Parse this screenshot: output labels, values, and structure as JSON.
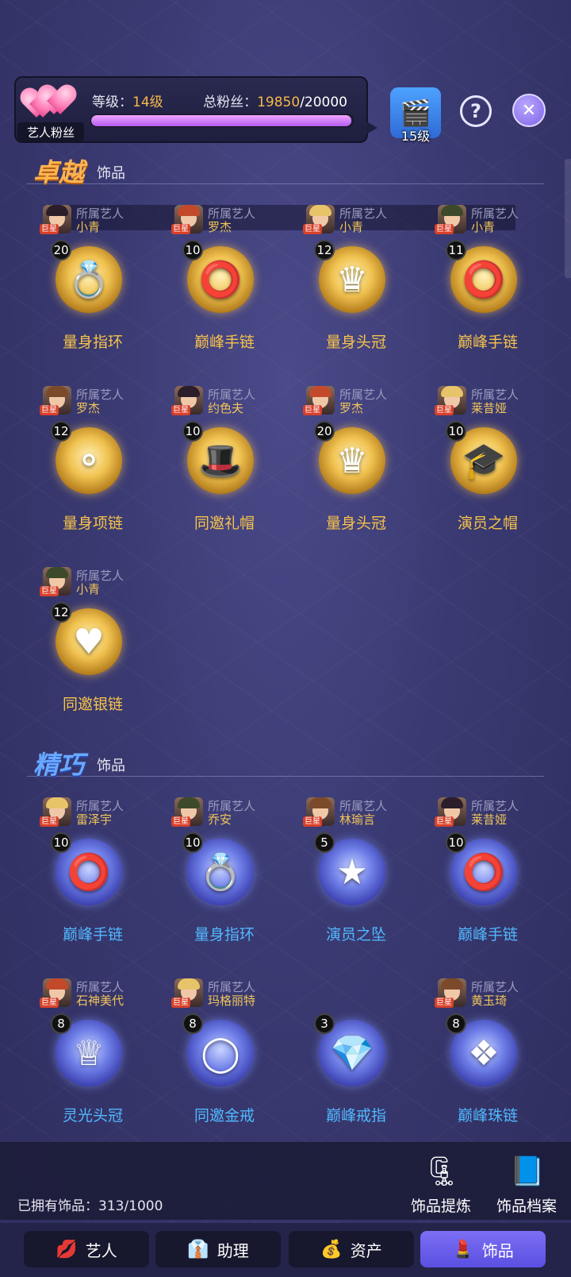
{
  "header": {
    "fan_tag": "艺人粉丝",
    "level_label": "等级：",
    "level_value": "14级",
    "fans_label": "总粉丝：",
    "fans_value": "19850",
    "fans_max": "/20000",
    "fans_progress_fraction": 0.9925,
    "next_level": "15级"
  },
  "sections": {
    "excellent": {
      "title": "卓越",
      "sub": "饰品"
    },
    "exquisite": {
      "title": "精巧",
      "sub": "饰品"
    }
  },
  "owner_label": "所属艺人",
  "star_badge": "巨星",
  "excellent_items": [
    {
      "owner": "小青",
      "count": "20",
      "name": "量身指环",
      "icon": "ring-icon",
      "glyph": "💍"
    },
    {
      "owner": "罗杰",
      "count": "10",
      "name": "巅峰手链",
      "icon": "bracelet-icon",
      "glyph": "⭕"
    },
    {
      "owner": "小青",
      "count": "12",
      "name": "量身头冠",
      "icon": "crown-icon",
      "glyph": "♛"
    },
    {
      "owner": "小青",
      "count": "11",
      "name": "巅峰手链",
      "icon": "bracelet-icon",
      "glyph": "⭕"
    },
    {
      "owner": "罗杰",
      "count": "12",
      "name": "量身项链",
      "icon": "necklace-icon",
      "glyph": "⚬"
    },
    {
      "owner": "约色夫",
      "count": "10",
      "name": "同邀礼帽",
      "icon": "hat-icon",
      "glyph": "🎩"
    },
    {
      "owner": "罗杰",
      "count": "20",
      "name": "量身头冠",
      "icon": "crown-icon",
      "glyph": "♛"
    },
    {
      "owner": "莱昔娅",
      "count": "10",
      "name": "演员之帽",
      "icon": "wizard-hat-icon",
      "glyph": "🎓"
    },
    {
      "owner": "小青",
      "count": "12",
      "name": "同邀银链",
      "icon": "heart-pendant-icon",
      "glyph": "♥"
    }
  ],
  "exquisite_items": [
    {
      "owner": "雷泽宇",
      "count": "10",
      "name": "巅峰手链",
      "icon": "bracelet-icon",
      "glyph": "⭕"
    },
    {
      "owner": "乔安",
      "count": "10",
      "name": "量身指环",
      "icon": "ring-icon",
      "glyph": "💍"
    },
    {
      "owner": "林瑜言",
      "count": "5",
      "name": "演员之坠",
      "icon": "star-pendant-icon",
      "glyph": "★"
    },
    {
      "owner": "莱昔娅",
      "count": "10",
      "name": "巅峰手链",
      "icon": "bracelet-icon",
      "glyph": "⭕"
    },
    {
      "owner": "石神美代",
      "count": "8",
      "name": "灵光头冠",
      "icon": "tiara-icon",
      "glyph": "♕"
    },
    {
      "owner": "玛格丽特",
      "count": "8",
      "name": "同邀金戒",
      "icon": "band-ring-icon",
      "glyph": "◯"
    },
    {
      "owner": "",
      "count": "3",
      "name": "巅峰戒指",
      "icon": "gem-ring-icon",
      "glyph": "💎"
    },
    {
      "owner": "黄玉琦",
      "count": "8",
      "name": "巅峰珠链",
      "icon": "jewel-necklace-icon",
      "glyph": "❖"
    }
  ],
  "footer": {
    "owned_label": "已拥有饰品：",
    "owned_value": "313/1000",
    "refine": "饰品提炼",
    "archive": "饰品档案"
  },
  "tabs": [
    {
      "label": "艺人",
      "icon": "artist-icon",
      "glyph": "💋"
    },
    {
      "label": "助理",
      "icon": "assistant-icon",
      "glyph": "👔"
    },
    {
      "label": "资产",
      "icon": "assets-icon",
      "glyph": "💰"
    },
    {
      "label": "饰品",
      "icon": "accessory-icon",
      "glyph": "💄"
    }
  ],
  "colors": {
    "accent_gold": "#f6c24a",
    "accent_blue": "#52b8ff",
    "active_tab": "#6a5ff0"
  }
}
